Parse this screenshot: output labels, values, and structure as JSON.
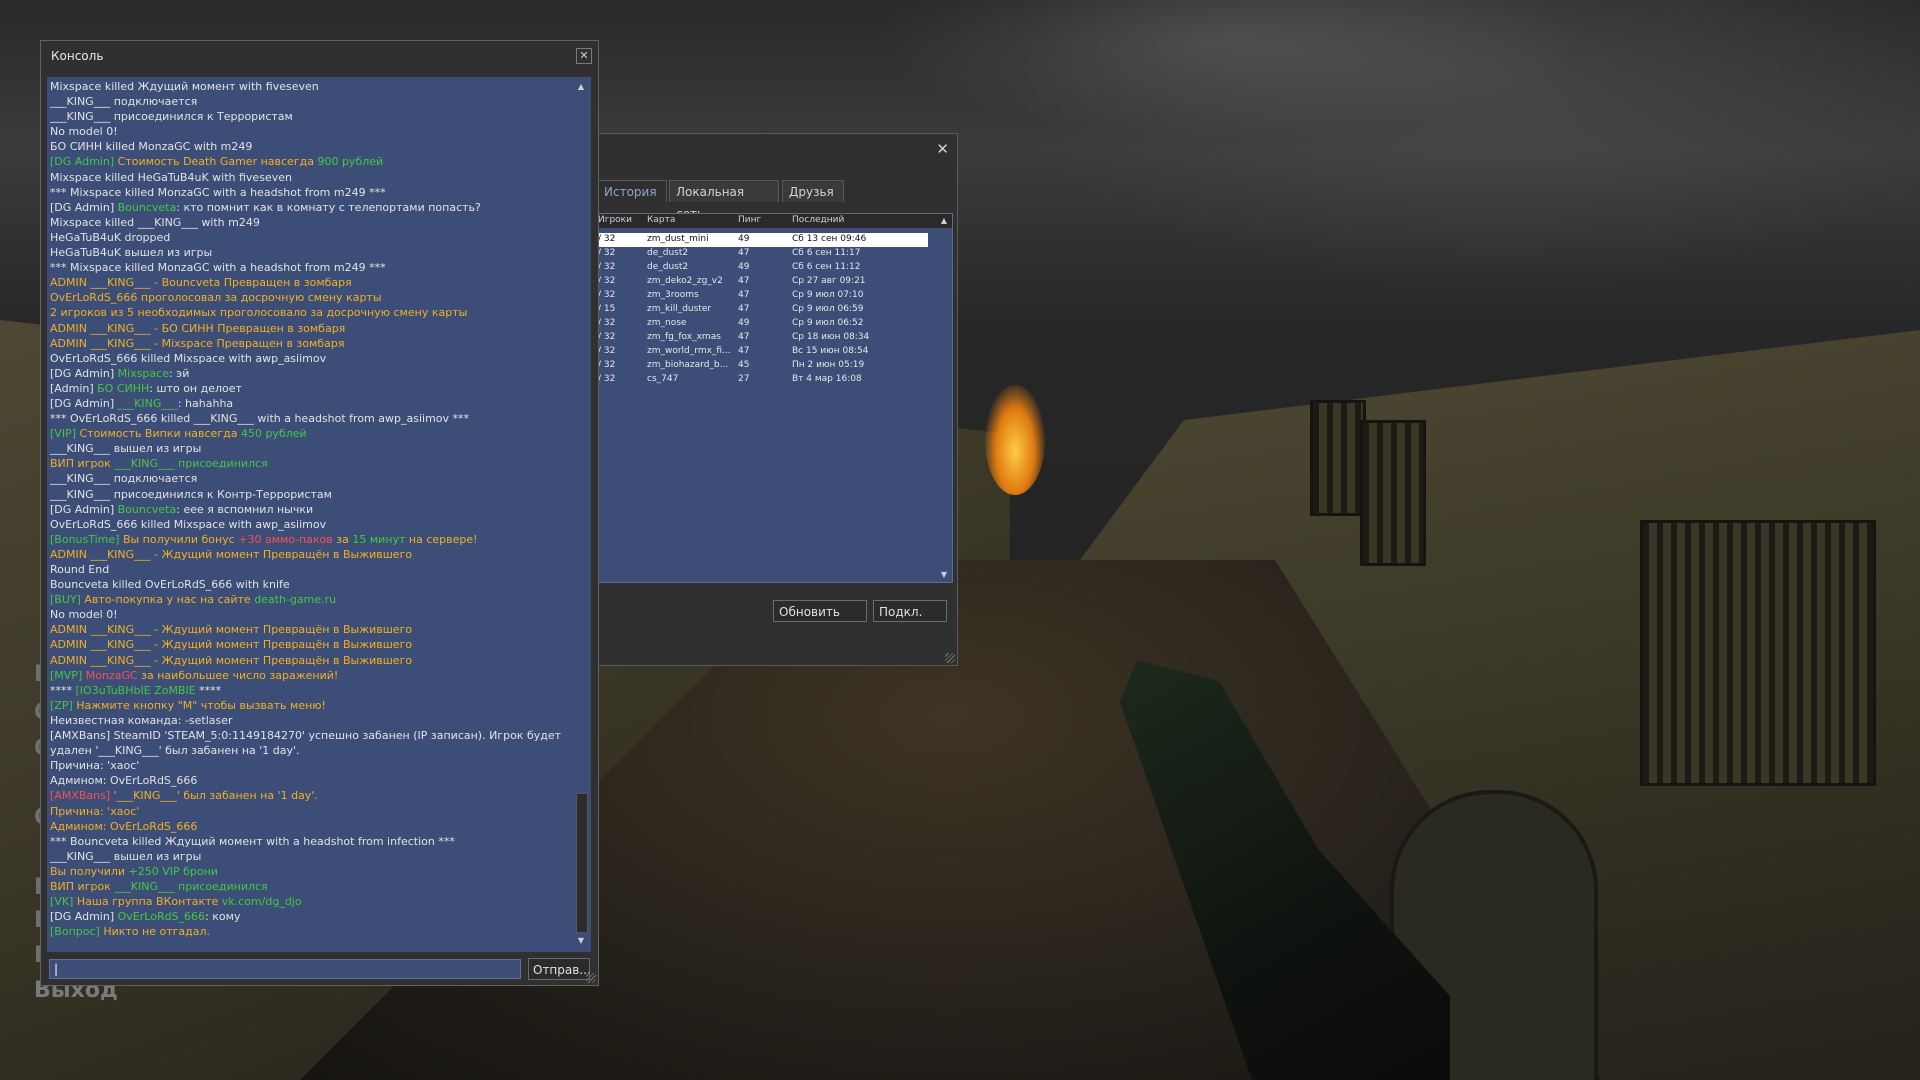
{
  "background": {
    "menu_exit": "Выход",
    "menu_partial": [
      "Н",
      "С",
      "С",
      "С",
      "К",
      "К",
      "К"
    ]
  },
  "server_browser": {
    "tabs": [
      {
        "label": "История",
        "active": true
      },
      {
        "label": "Локальная сеть",
        "active": false
      },
      {
        "label": "Друзья",
        "active": false
      }
    ],
    "columns": {
      "players": "Игроки",
      "map": "Карта",
      "ping": "Пинг",
      "last": "Последний"
    },
    "rows": [
      {
        "players": "/ 32",
        "map": "zm_dust_mini",
        "ping": "49",
        "last": "Сб 13 сен 09:46",
        "selected": true
      },
      {
        "players": "/ 32",
        "map": "de_dust2",
        "ping": "47",
        "last": "Сб  6 сен 11:17"
      },
      {
        "players": "/ 32",
        "map": "de_dust2",
        "ping": "49",
        "last": "Сб  6 сен 11:12"
      },
      {
        "players": "/ 32",
        "map": "zm_deko2_zg_v2",
        "ping": "47",
        "last": "Ср 27 авг 09:21"
      },
      {
        "players": "/ 32",
        "map": "zm_3rooms",
        "ping": "47",
        "last": "Ср  9 июл 07:10"
      },
      {
        "players": "/ 15",
        "map": "zm_kill_duster",
        "ping": "47",
        "last": "Ср  9 июл 06:59"
      },
      {
        "players": "/ 32",
        "map": "zm_nose",
        "ping": "49",
        "last": "Ср  9 июл 06:52"
      },
      {
        "players": "/ 32",
        "map": "zm_fg_fox_xmas",
        "ping": "47",
        "last": "Ср 18 июн 08:34"
      },
      {
        "players": "/ 32",
        "map": "zm_world_rmx_fi...",
        "ping": "47",
        "last": "Вс 15 июн 08:54"
      },
      {
        "players": "/ 32",
        "map": "zm_biohazard_b...",
        "ping": "45",
        "last": "Пн  2 июн 05:19"
      },
      {
        "players": "/ 32",
        "map": "cs_747",
        "ping": "27",
        "last": "Вт  4 мар 16:08"
      }
    ],
    "refresh_label": "Обновить",
    "connect_label": "Подкл.",
    "close_glyph": "✕"
  },
  "console": {
    "title": "Консоль",
    "close_glyph": "✕",
    "send_label": "Отправ...",
    "input_value": "|",
    "lines": [
      [
        {
          "t": "Mixspace killed Ждущий момент with fiveseven",
          "c": "def"
        }
      ],
      [
        {
          "t": "___KING___ подключается",
          "c": "def"
        }
      ],
      [
        {
          "t": "___KING___ присоединился к Террористам",
          "c": "def"
        }
      ],
      [
        {
          "t": "No model 0!",
          "c": "def"
        }
      ],
      [
        {
          "t": "БО СИНН killed MonzaGC with m249",
          "c": "def"
        }
      ],
      [
        {
          "t": "[DG Admin] ",
          "c": "g"
        },
        {
          "t": "Стоимость Death Gamer навсегда ",
          "c": "y"
        },
        {
          "t": "900 рублей",
          "c": "g"
        }
      ],
      [
        {
          "t": "Mixspace killed HeGaTuB4uK with fiveseven",
          "c": "def"
        }
      ],
      [
        {
          "t": "*** Mixspace killed MonzaGC with a headshot from m249 ***",
          "c": "def"
        }
      ],
      [
        {
          "t": "[DG Admin] ",
          "c": "def"
        },
        {
          "t": "Bouncveta",
          "c": "g"
        },
        {
          "t": ": кто помнит как в комнату с телепортами попасть?",
          "c": "def"
        }
      ],
      [
        {
          "t": "Mixspace killed ___KING___ with m249",
          "c": "def"
        }
      ],
      [
        {
          "t": "HeGaTuB4uK dropped",
          "c": "def"
        }
      ],
      [
        {
          "t": "HeGaTuB4uK вышел из игры",
          "c": "def"
        }
      ],
      [
        {
          "t": "*** Mixspace killed MonzaGC with a headshot from m249 ***",
          "c": "def"
        }
      ],
      [
        {
          "t": "ADMIN ___KING___ - Bouncveta Превращен в зомбаря",
          "c": "y"
        }
      ],
      [
        {
          "t": "OvErLoRdS_666 проголосовал за досрочную смену карты",
          "c": "y"
        }
      ],
      [
        {
          "t": "2 игроков из 5 необходимых проголосовало за досрочную смену карты",
          "c": "y"
        }
      ],
      [
        {
          "t": "ADMIN ___KING___ - БО СИНН Превращен в зомбаря",
          "c": "y"
        }
      ],
      [
        {
          "t": "ADMIN ___KING___ - Mixspace Превращен в зомбаря",
          "c": "y"
        }
      ],
      [
        {
          "t": "OvErLoRdS_666 killed Mixspace with awp_asiimov",
          "c": "def"
        }
      ],
      [
        {
          "t": "[DG Admin] ",
          "c": "def"
        },
        {
          "t": "Mixspace",
          "c": "g"
        },
        {
          "t": ": эй",
          "c": "def"
        }
      ],
      [
        {
          "t": "[Admin] ",
          "c": "def"
        },
        {
          "t": "БО СИНН",
          "c": "g"
        },
        {
          "t": ": што он делоет",
          "c": "def"
        }
      ],
      [
        {
          "t": "[DG Admin] ",
          "c": "def"
        },
        {
          "t": "___KING___",
          "c": "g"
        },
        {
          "t": ": hahahha",
          "c": "def"
        }
      ],
      [
        {
          "t": "*** OvErLoRdS_666 killed ___KING___ with a headshot from awp_asiimov ***",
          "c": "def"
        }
      ],
      [
        {
          "t": "[VIP] ",
          "c": "g"
        },
        {
          "t": "Стоимость Випки навсегда ",
          "c": "y"
        },
        {
          "t": "450 рублей",
          "c": "g"
        }
      ],
      [
        {
          "t": "___KING___ вышел из игры",
          "c": "def"
        }
      ],
      [
        {
          "t": "ВИП игрок ",
          "c": "y"
        },
        {
          "t": "___KING___ присоединился",
          "c": "g"
        }
      ],
      [
        {
          "t": "___KING___ подключается",
          "c": "def"
        }
      ],
      [
        {
          "t": "___KING___ присоединился к Контр-Террористам",
          "c": "def"
        }
      ],
      [
        {
          "t": "[DG Admin] ",
          "c": "def"
        },
        {
          "t": "Bouncveta",
          "c": "g"
        },
        {
          "t": ": еее я вспомнил нычки",
          "c": "def"
        }
      ],
      [
        {
          "t": "OvErLoRdS_666 killed Mixspace with awp_asiimov",
          "c": "def"
        }
      ],
      [
        {
          "t": "[BonusTime] ",
          "c": "g"
        },
        {
          "t": "Вы получили бонус ",
          "c": "y"
        },
        {
          "t": "+30 аммо-паков",
          "c": "r"
        },
        {
          "t": " за ",
          "c": "y"
        },
        {
          "t": "15 минут",
          "c": "g"
        },
        {
          "t": " на сервере!",
          "c": "y"
        }
      ],
      [
        {
          "t": "ADMIN ___KING___ - Ждущий момент Превращён в Выжившего",
          "c": "y"
        }
      ],
      [
        {
          "t": "Round End",
          "c": "def"
        }
      ],
      [
        {
          "t": "Bouncveta killed OvErLoRdS_666 with knife",
          "c": "def"
        }
      ],
      [
        {
          "t": "[BUY] ",
          "c": "g"
        },
        {
          "t": "Авто-покупка у нас на сайте ",
          "c": "y"
        },
        {
          "t": "death-game.ru",
          "c": "g"
        }
      ],
      [
        {
          "t": "No model 0!",
          "c": "def"
        }
      ],
      [
        {
          "t": "ADMIN ___KING___ - Ждущий момент Превращён в Выжившего",
          "c": "y"
        }
      ],
      [
        {
          "t": "ADMIN ___KING___ - Ждущий момент Превращён в Выжившего",
          "c": "y"
        }
      ],
      [
        {
          "t": "ADMIN ___KING___ - Ждущий момент Превращён в Выжившего",
          "c": "y"
        }
      ],
      [
        {
          "t": "[MVP] ",
          "c": "g"
        },
        {
          "t": "MonzaGC",
          "c": "r"
        },
        {
          "t": " за наибольшее число заражений!",
          "c": "y"
        }
      ],
      [
        {
          "t": "**** ",
          "c": "def"
        },
        {
          "t": "[IO3uTuBHbIE ZoMBIE",
          "c": "g"
        },
        {
          "t": " ****",
          "c": "def"
        }
      ],
      [
        {
          "t": "[ZP] ",
          "c": "g"
        },
        {
          "t": "Нажмите кнопку \"M\" чтобы вызвать меню!",
          "c": "y"
        }
      ],
      [
        {
          "t": "Неизвестная команда: -setlaser",
          "c": "def"
        }
      ],
      [
        {
          "t": "[AMXBans] SteamID 'STEAM_5:0:1149184270' успешно забанен (IP записан). Игрок будет",
          "c": "def"
        }
      ],
      [
        {
          "t": "удален '___KING___' был забанен на '1 day'.",
          "c": "def"
        }
      ],
      [
        {
          "t": " Причина: 'хаос'",
          "c": "def"
        }
      ],
      [
        {
          "t": " Админом: OvErLoRdS_666",
          "c": "def"
        }
      ],
      [
        {
          "t": "[AMXBans] ",
          "c": "r"
        },
        {
          "t": "'___KING___' был забанен на '1 day'.",
          "c": "y"
        }
      ],
      [
        {
          "t": " Причина: 'хаос'",
          "c": "y"
        }
      ],
      [
        {
          "t": " Админом: OvErLoRdS_666",
          "c": "y"
        }
      ],
      [
        {
          "t": "*** Bouncveta killed Ждущий момент with a headshot from infection ***",
          "c": "def"
        }
      ],
      [
        {
          "t": "___KING___ вышел из игры",
          "c": "def"
        }
      ],
      [
        {
          "t": "Вы получили ",
          "c": "y"
        },
        {
          "t": "+250 VIP брони",
          "c": "g"
        }
      ],
      [
        {
          "t": "ВИП игрок ",
          "c": "y"
        },
        {
          "t": "___KING___ присоединился",
          "c": "g"
        }
      ],
      [
        {
          "t": "[VK] ",
          "c": "g"
        },
        {
          "t": "Наша группа ВКонтакте ",
          "c": "y"
        },
        {
          "t": "vk.com/dg_djo",
          "c": "g"
        }
      ],
      [
        {
          "t": "[DG Admin] ",
          "c": "def"
        },
        {
          "t": "OvErLoRdS_666",
          "c": "g"
        },
        {
          "t": ": кому",
          "c": "def"
        }
      ],
      [
        {
          "t": "[Вопрос] ",
          "c": "g"
        },
        {
          "t": "Никто не отгадал.",
          "c": "y"
        }
      ]
    ]
  },
  "colors": {
    "log_bg": "#3c4e78",
    "default_text": "#e2e2e2",
    "yellow": "#f2b021",
    "green": "#42c842",
    "red": "#f45050"
  }
}
